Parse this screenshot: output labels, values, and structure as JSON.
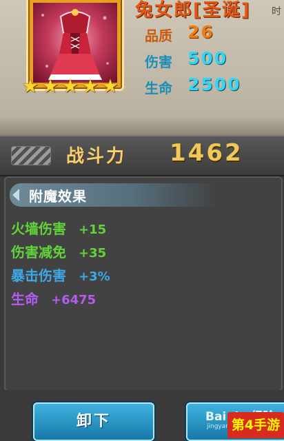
{
  "item": {
    "title": "兔女郎[圣诞]",
    "title_suffix": "时",
    "portrait_icon": "red-dress-icon",
    "stars": [
      "★",
      "★",
      "★",
      "★",
      "★"
    ],
    "stats": {
      "quality_label": "品质",
      "quality_value": "26",
      "damage_label": "伤害",
      "damage_value": "500",
      "life_label": "生命",
      "life_value": "2500"
    }
  },
  "power": {
    "label": "战斗力",
    "value": "1462"
  },
  "enchant": {
    "title": "附魔效果",
    "effects": [
      {
        "name": "火墙伤害",
        "value": "+15"
      },
      {
        "name": "伤害减免",
        "value": "+35"
      },
      {
        "name": "暴击伤害",
        "value": "+3%"
      },
      {
        "name": "生命",
        "value": "+6475"
      }
    ]
  },
  "buttons": {
    "unequip": "卸下"
  },
  "watermark": {
    "badge": "第4手游",
    "baidu": "Bai du 经验",
    "baidu_sub": "jingyan.baidu.com"
  },
  "colors": {
    "title": "#e35714",
    "stat_value": "#35d4f2",
    "power": "#f0c75a",
    "effect_green": "#62d43a",
    "effect_blue": "#3da8e6",
    "effect_purple": "#b35cf2",
    "button": "#1778a8"
  }
}
